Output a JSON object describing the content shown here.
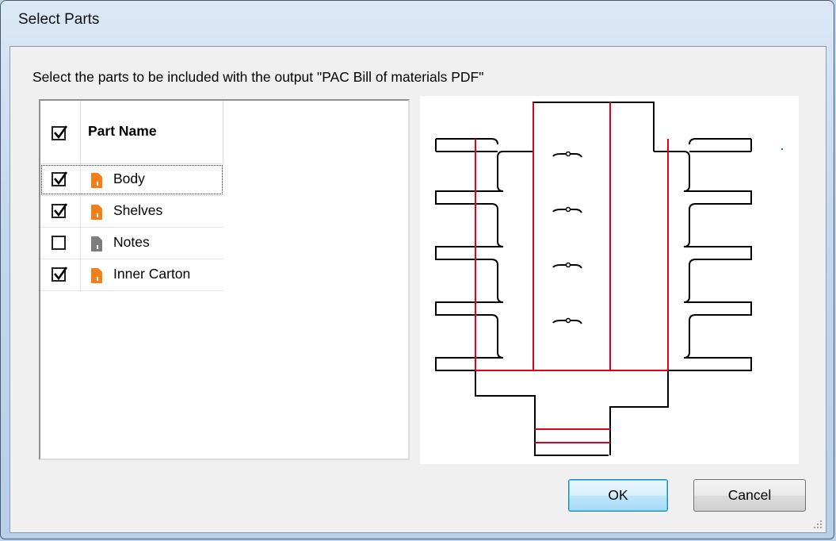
{
  "window": {
    "title": "Select Parts"
  },
  "instruction": "Select the parts to be included with the output \"PAC Bill of materials PDF\"",
  "list": {
    "header_label": "Part Name",
    "header_checked": true,
    "rows": [
      {
        "label": "Body",
        "checked": true,
        "icon": "orange-part-icon",
        "focused": true
      },
      {
        "label": "Shelves",
        "checked": true,
        "icon": "orange-part-icon",
        "focused": false
      },
      {
        "label": "Notes",
        "checked": false,
        "icon": "gray-part-icon",
        "focused": false
      },
      {
        "label": "Inner Carton",
        "checked": true,
        "icon": "orange-part-icon",
        "focused": false
      }
    ]
  },
  "buttons": {
    "ok": "OK",
    "cancel": "Cancel"
  },
  "colors": {
    "part_orange": "#f57f17",
    "part_gray": "#7d7d7d",
    "crease_red": "#e0001b",
    "cut_black": "#000000"
  }
}
